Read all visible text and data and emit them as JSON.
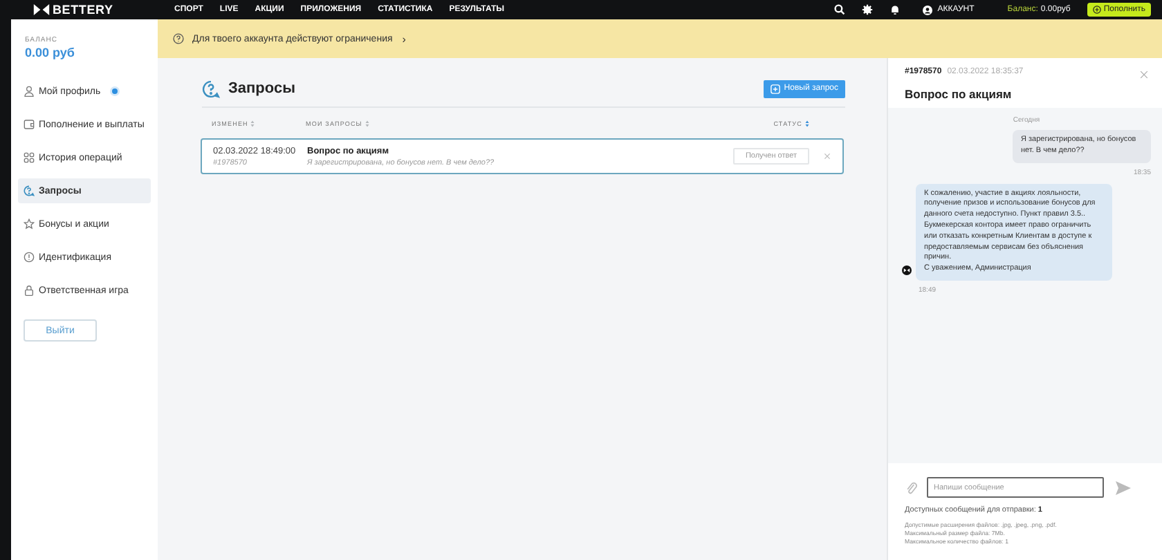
{
  "topbar": {
    "logo": "BETTERY",
    "nav": [
      {
        "label": "СПОРТ"
      },
      {
        "label": "LIVE"
      },
      {
        "label": "АКЦИИ"
      },
      {
        "label": "ПРИЛОЖЕНИЯ"
      },
      {
        "label": "СТАТИСТИКА"
      },
      {
        "label": "РЕЗУЛЬТАТЫ"
      }
    ],
    "account": "АККАУНТ",
    "balance_label": "Баланс:",
    "balance_value": "0.00руб",
    "deposit": "Пополнить"
  },
  "sidebar": {
    "balance_label": "БАЛАНС",
    "balance": "0.00 руб",
    "items": [
      {
        "label": "Мой профиль",
        "selected": false,
        "dot": true
      },
      {
        "label": "Пополнение и выплаты",
        "selected": false,
        "dot": false
      },
      {
        "label": "История операций",
        "selected": false,
        "dot": false
      },
      {
        "label": "Запросы",
        "selected": true,
        "dot": false
      },
      {
        "label": "Бонусы и акции",
        "selected": false,
        "dot": false
      },
      {
        "label": "Идентификация",
        "selected": false,
        "dot": false
      },
      {
        "label": "Ответственная игра",
        "selected": false,
        "dot": false
      }
    ],
    "logout": "Выйти"
  },
  "banner": {
    "text": "Для твоего аккаунта действуют ограничения",
    "arrow": "›"
  },
  "requests": {
    "title": "Запросы",
    "new_button": "Новый запрос",
    "columns": [
      {
        "label": "ИЗМЕНЕН",
        "sorted": false
      },
      {
        "label": "МОИ ЗАПРОСЫ",
        "sorted": false
      },
      {
        "label": "СТАТУС",
        "sorted": true
      }
    ],
    "rows": [
      {
        "date": "02.03.2022 18:49:00",
        "id": "#1978570",
        "subject": "Вопрос по акциям",
        "preview": "Я зарегистрирована, но бонусов нет. В чем дело??",
        "status": "Получен ответ",
        "selected": true
      }
    ]
  },
  "chat": {
    "id": "#1978570",
    "date": "02.03.2022 18:35:37",
    "title": "Вопрос по акциям",
    "day": "Сегодня",
    "messages": [
      {
        "kind": "user",
        "lines": [
          "Я зарегистрирована, но бонусов нет. В чем дело??"
        ],
        "time": "18:35"
      },
      {
        "kind": "admin",
        "lines": [
          "К сожалению, участие в акциях лояльности, получение призов и использование бонусов для данного счета недоступно.  Пункт правил 3.5.. Букмекерская контора имеет право ограничить или отказать конкретным Клиентам в доступе к предоставляемым сервисам без объяснения причин.",
          "С уважением, Администрация"
        ],
        "time": "18:49"
      }
    ],
    "input_placeholder": "Напиши сообщение",
    "available": "Доступных сообщений для отправки: **1**",
    "notes": [
      "Допустимые расширения файлов: .jpg, .jpeg, .png, .pdf.",
      "Максимальный размер файла: 7Mb.",
      "Максимальное количество файлов: 1"
    ]
  }
}
